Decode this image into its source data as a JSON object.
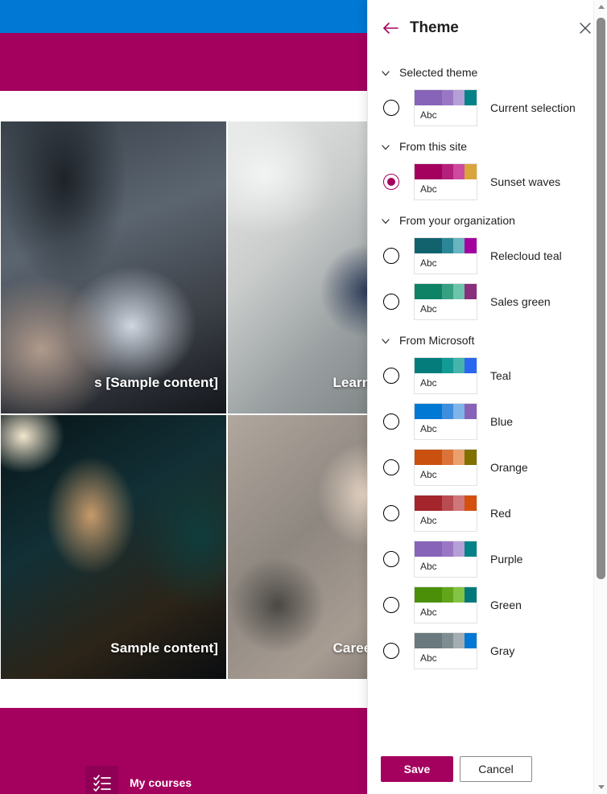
{
  "background": {
    "brand_color": "#a4005e",
    "top_bar_color": "#0078d4",
    "tiles": [
      {
        "title": "s [Sample content]"
      },
      {
        "title": "Learn a new lang"
      },
      {
        "title": "Sample content]"
      },
      {
        "title": "Career developm"
      }
    ],
    "nav": {
      "courses_label": "My courses",
      "courses_icon": "checklist-icon"
    }
  },
  "panel": {
    "title": "Theme",
    "back_icon": "back-arrow-icon",
    "close_icon": "close-icon",
    "chevron_icon": "chevron-down-icon",
    "swatch_sample_text": "Abc",
    "sections": [
      {
        "id": "selected-theme",
        "label": "Selected theme",
        "expanded": true,
        "themes": [
          {
            "name": "Current selection",
            "selected": false,
            "colors": [
              "#8764b8",
              "#9a77c4",
              "#b4a0d6",
              "#038387"
            ],
            "widths": [
              44,
              18,
              18,
              20
            ]
          }
        ]
      },
      {
        "id": "from-this-site",
        "label": "From this site",
        "expanded": true,
        "themes": [
          {
            "name": "Sunset waves",
            "selected": true,
            "colors": [
              "#a4005e",
              "#b5207c",
              "#cc4ba0",
              "#d9a53b"
            ],
            "widths": [
              44,
              18,
              18,
              20
            ]
          }
        ]
      },
      {
        "id": "from-your-organization",
        "label": "From your organization",
        "expanded": true,
        "themes": [
          {
            "name": "Relecloud teal",
            "selected": false,
            "colors": [
              "#11626d",
              "#2b8796",
              "#68b4bf",
              "#a4009e"
            ],
            "widths": [
              44,
              18,
              18,
              20
            ]
          },
          {
            "name": "Sales green",
            "selected": false,
            "colors": [
              "#0f8265",
              "#36a083",
              "#6cc4ab",
              "#8a2f7b"
            ],
            "widths": [
              44,
              18,
              18,
              20
            ]
          }
        ]
      },
      {
        "id": "from-microsoft",
        "label": "From Microsoft",
        "expanded": true,
        "themes": [
          {
            "name": "Teal",
            "selected": false,
            "colors": [
              "#047c7c",
              "#149a96",
              "#46b3ad",
              "#2b66f0"
            ],
            "widths": [
              44,
              18,
              18,
              20
            ]
          },
          {
            "name": "Blue",
            "selected": false,
            "colors": [
              "#0078d4",
              "#3f8ede",
              "#7fb5e8",
              "#8764b8"
            ],
            "widths": [
              44,
              18,
              18,
              20
            ]
          },
          {
            "name": "Orange",
            "selected": false,
            "colors": [
              "#ca5010",
              "#db7339",
              "#e9a06c",
              "#807000"
            ],
            "widths": [
              44,
              18,
              18,
              20
            ]
          },
          {
            "name": "Red",
            "selected": false,
            "colors": [
              "#a4262c",
              "#b94c51",
              "#cf767a",
              "#d4500f"
            ],
            "widths": [
              44,
              18,
              18,
              20
            ]
          },
          {
            "name": "Purple",
            "selected": false,
            "colors": [
              "#8764b8",
              "#9a77c4",
              "#b4a0d6",
              "#038387"
            ],
            "widths": [
              44,
              18,
              18,
              20
            ]
          },
          {
            "name": "Green",
            "selected": false,
            "colors": [
              "#4a8f07",
              "#62a51b",
              "#83c344",
              "#00787b"
            ],
            "widths": [
              44,
              18,
              18,
              20
            ]
          },
          {
            "name": "Gray",
            "selected": false,
            "colors": [
              "#69797e",
              "#7f8d92",
              "#a3adb2",
              "#0078d4"
            ],
            "widths": [
              44,
              18,
              18,
              20
            ]
          }
        ]
      }
    ],
    "footer": {
      "save_label": "Save",
      "cancel_label": "Cancel"
    },
    "scrollbar": {
      "up_icon": "scroll-up-arrow-icon",
      "down_icon": "scroll-down-arrow-icon"
    }
  }
}
